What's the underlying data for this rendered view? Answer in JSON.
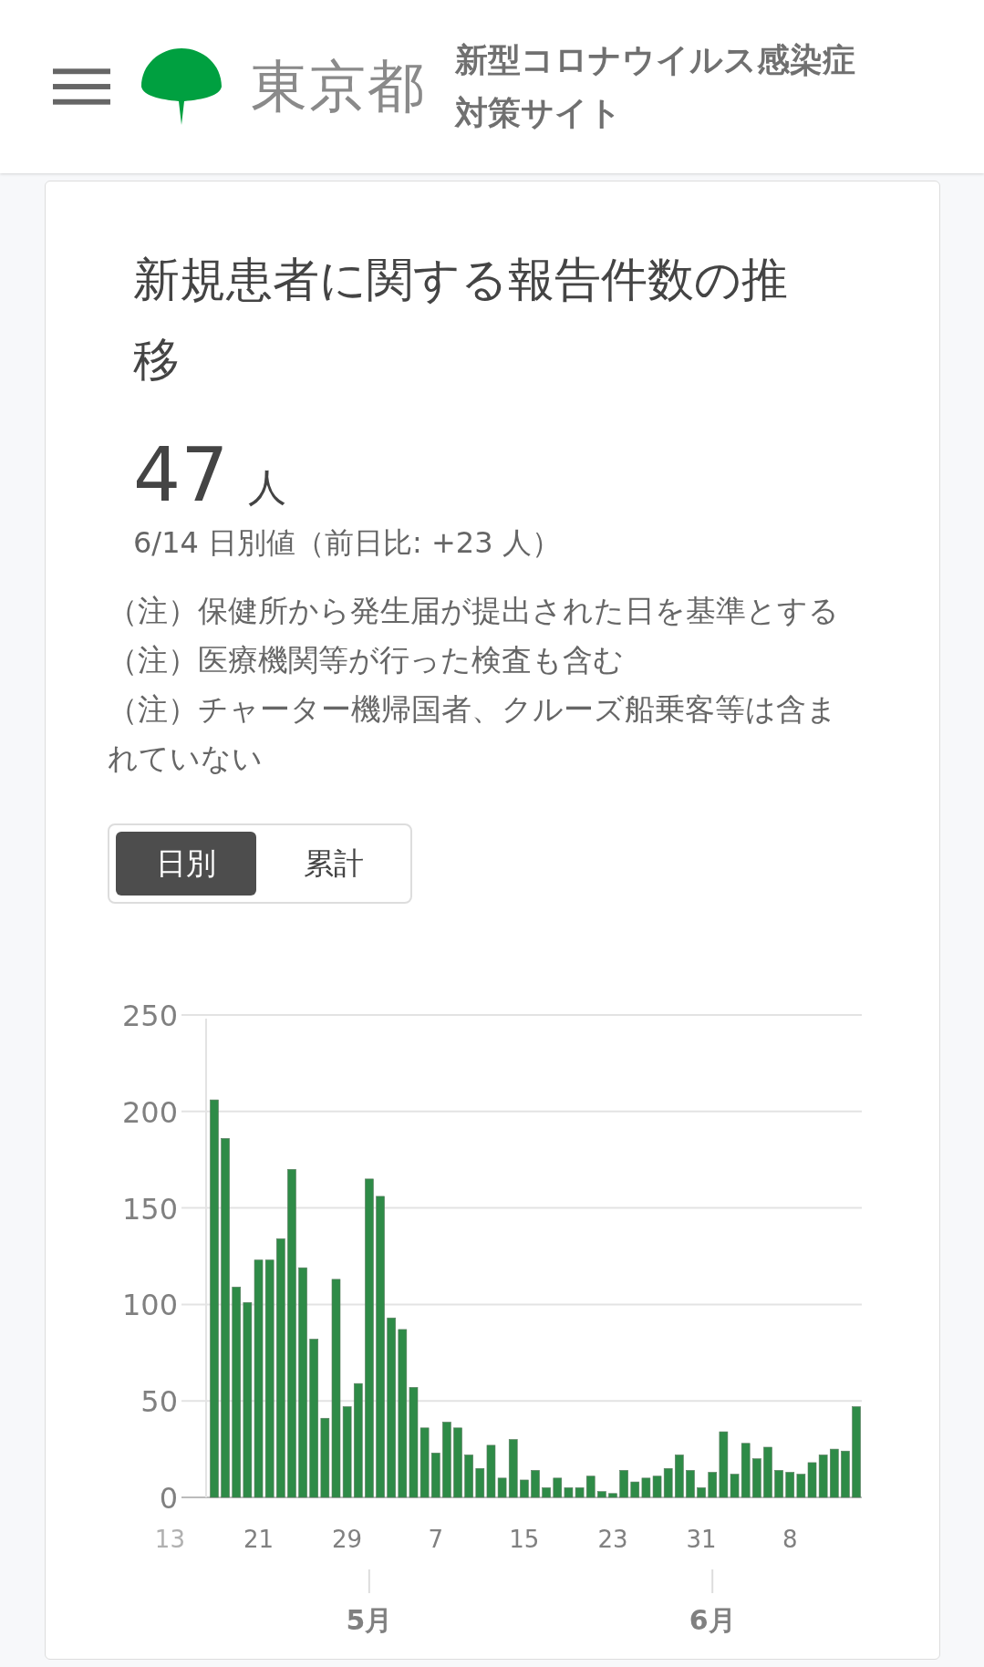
{
  "header": {
    "logo_text": "東京都",
    "site_title": [
      "新型コロナウイルス感染症",
      "対策サイト"
    ]
  },
  "card": {
    "title": "新規患者に関する報告件数の推移",
    "total": {
      "value": "47",
      "unit": "人"
    },
    "date_line": "6/14 日別値（前日比: +23 人）",
    "notes": [
      "（注）保健所から発生届が提出された日を基準とする",
      "（注）医療機関等が行った検査も含む",
      "（注）チャーター機帰国者、クルーズ船乗客等は含まれていない"
    ],
    "toggle": [
      {
        "label": "日別",
        "selected": true
      },
      {
        "label": "累計",
        "selected": false
      }
    ],
    "chart_data": {
      "type": "bar",
      "ylim": [
        0,
        250
      ],
      "yticks": [
        0,
        50,
        100,
        150,
        200,
        250
      ],
      "grid": true,
      "categories": [
        "13",
        null,
        null,
        null,
        null,
        null,
        null,
        null,
        "21",
        null,
        null,
        null,
        null,
        null,
        null,
        null,
        "29",
        null,
        null,
        null,
        null,
        null,
        null,
        null,
        "7",
        null,
        null,
        null,
        null,
        null,
        null,
        null,
        "15",
        null,
        null,
        null,
        null,
        null,
        null,
        null,
        "23",
        null,
        null,
        null,
        null,
        null,
        null,
        null,
        "31",
        null,
        null,
        null,
        null,
        null,
        null,
        null,
        "8",
        null,
        null,
        null,
        null,
        null,
        null
      ],
      "annotations": [
        "5月",
        "6月"
      ],
      "series": [
        {
          "color": "#2e8b47",
          "values": [
            null,
            null,
            null,
            null,
            206,
            186,
            109,
            101,
            123,
            123,
            134,
            170,
            119,
            82,
            41,
            113,
            47,
            59,
            165,
            156,
            93,
            87,
            57,
            36,
            23,
            39,
            36,
            22,
            15,
            27,
            10,
            30,
            9,
            14,
            5,
            10,
            5,
            5,
            11,
            3,
            2,
            14,
            8,
            10,
            11,
            15,
            22,
            14,
            5,
            13,
            34,
            12,
            28,
            20,
            26,
            14,
            13,
            12,
            18,
            22,
            25,
            24,
            47
          ]
        }
      ]
    }
  }
}
